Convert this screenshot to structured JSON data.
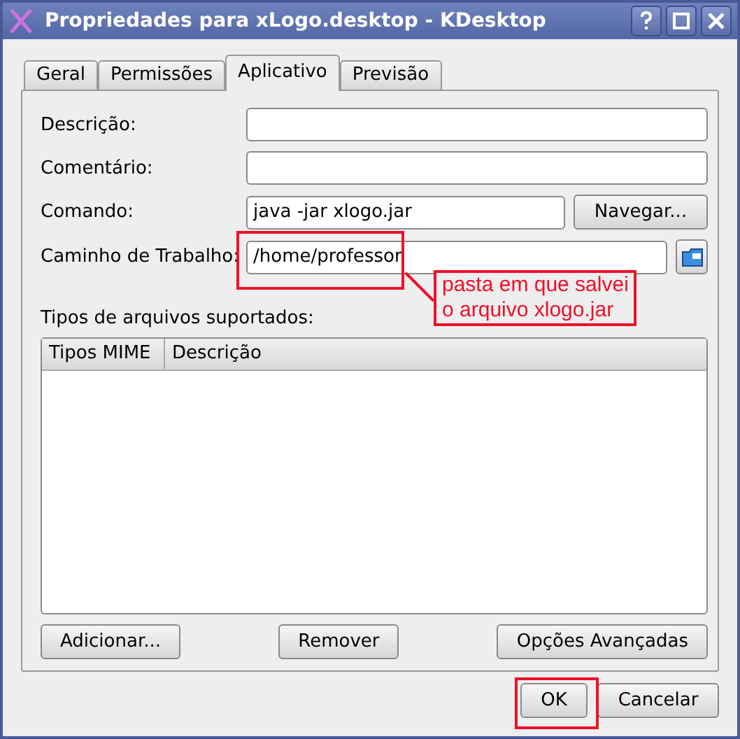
{
  "window": {
    "title": "Propriedades para xLogo.desktop - KDesktop"
  },
  "tabs": [
    {
      "label": "Geral",
      "selected": false
    },
    {
      "label": "Permissões",
      "selected": false
    },
    {
      "label": "Aplicativo",
      "selected": true
    },
    {
      "label": "Previsão",
      "selected": false
    }
  ],
  "fields": [
    {
      "kind": "text",
      "label": "Descrição:"
    },
    {
      "kind": "text",
      "label": "Comentário:"
    },
    {
      "kind": "browse",
      "label": "Comando:",
      "value": "java -jar xlogo.jar",
      "button": "Navegar..."
    },
    {
      "kind": "folder",
      "label": "Caminho de Trabalho:",
      "value": "/home/professor",
      "highlighted": true
    }
  ],
  "file_types": {
    "label": "Tipos de arquivos suportados:",
    "columns": [
      "Tipos MIME",
      "Descrição"
    ]
  },
  "panel_buttons": [
    "Adicionar...",
    "Remover",
    "Opções Avançadas"
  ],
  "dialog_buttons": [
    {
      "label": "OK",
      "highlighted": true
    },
    {
      "label": "Cancelar",
      "highlighted": false
    }
  ],
  "callout": {
    "lines": [
      "pasta em que salvei",
      "o arquivo xlogo.jar"
    ]
  }
}
